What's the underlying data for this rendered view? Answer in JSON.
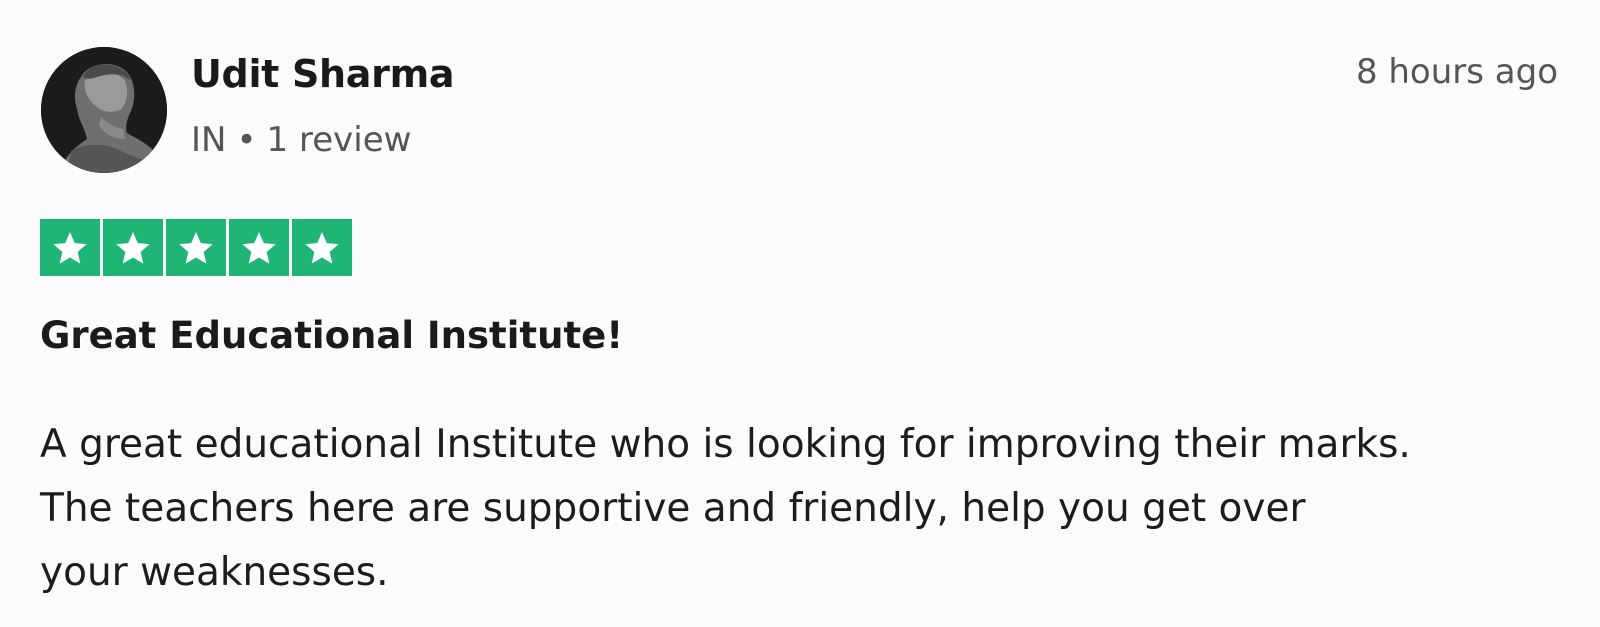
{
  "review": {
    "reviewer": {
      "name": "Udit Sharma",
      "country": "IN",
      "separator": "•",
      "review_count": "1 review"
    },
    "date": "8 hours ago",
    "rating": 5,
    "rating_color": "#1fb577",
    "title": "Great Educational Institute!",
    "body_lines": [
      "A great educational Institute who is looking for improving their marks.",
      "The teachers here are supportive and friendly, help you get over",
      "your weaknesses."
    ]
  }
}
